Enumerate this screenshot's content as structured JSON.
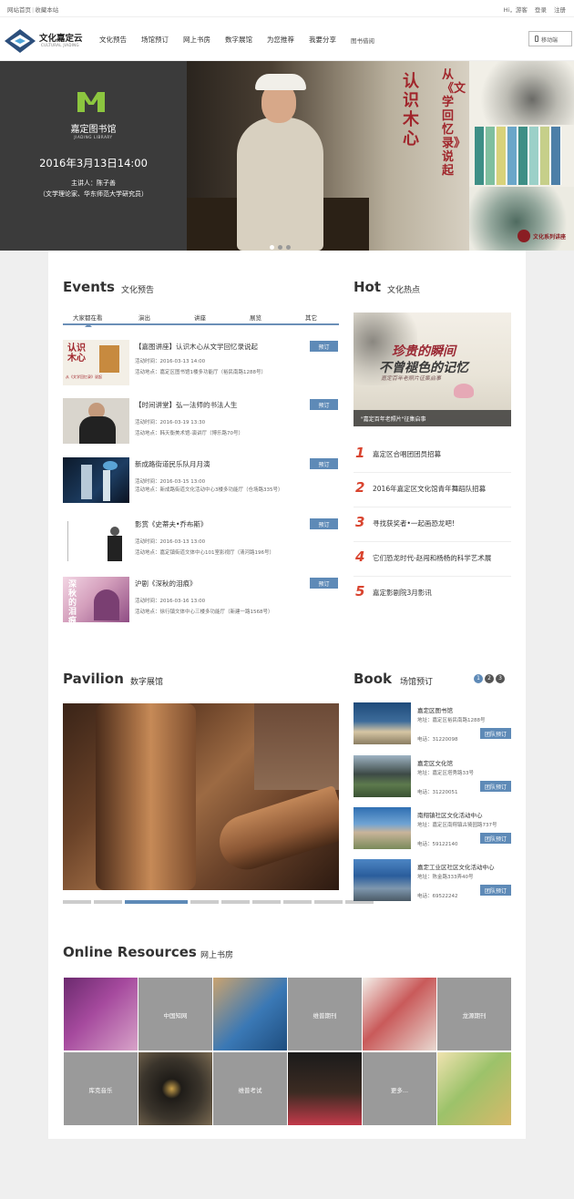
{
  "topbar": {
    "home": "网站首页",
    "favorite": "收藏本站",
    "greeting": "Hi，游客",
    "login": "登录",
    "register": "注册"
  },
  "brand": {
    "cn": "文化嘉定云",
    "en": "CULTURAL JIADING"
  },
  "nav": [
    "文化预告",
    "场馆预订",
    "网上书房",
    "数字展馆",
    "为您推荐",
    "我要分享",
    "图书借阅"
  ],
  "mobile": "移动端",
  "hero": {
    "library_cn": "嘉定图书馆",
    "library_en": "JIADING LIBRARY",
    "date": "2016年3月13日14:00",
    "speaker": "主讲人：陈子善",
    "desc": "（文学理论家、华东师范大学研究员）",
    "title_a": "认识木心",
    "title_b": "从《文学回忆录》说起",
    "series": "文化系列讲座",
    "slide_index": 1,
    "slide_count": 3
  },
  "events": {
    "title_en": "Events",
    "title_cn": "文化预告",
    "tabs": [
      "大家都在看",
      "演出",
      "讲座",
      "展览",
      "其它"
    ],
    "active_tab": "大家都在看",
    "items": [
      {
        "title": "【嘉图讲座】认识木心从文学回忆录说起",
        "time": "活动时间：2016-03-13 14:00",
        "place": "活动地点：嘉定区图书馆1楼多功能厅（裕民南路1288号）",
        "btn": "预订",
        "thumb": "book-cover"
      },
      {
        "title": "【时间讲堂】弘一法师的书法人生",
        "time": "活动时间：2016-03-19 13:30",
        "place": "活动地点：韩天衡美术馆-演讲厅（博乐路70号）",
        "btn": "预订",
        "thumb": "monk"
      },
      {
        "title": "新成路街道民乐队月月演",
        "time": "活动时间：2016-03-15 13:00",
        "place": "活动地点：新成路街道文化活动中心3楼多功能厅（仓场路335号）",
        "btn": "预订",
        "thumb": "stage"
      },
      {
        "title": "影赏《史蒂夫•乔布斯》",
        "time": "活动时间：2016-03-13 13:00",
        "place": "活动地点：嘉定镇街道文体中心101室影视厅（清河路196号）",
        "btn": "预订",
        "thumb": "poster"
      },
      {
        "title": "沪剧《深秋的泪痕》",
        "time": "活动时间：2016-03-16 13:00",
        "place": "活动地点：徐行镇文体中心三楼多功能厅（新建一路1568号）",
        "btn": "预订",
        "thumb": "opera"
      }
    ]
  },
  "hot": {
    "title_en": "Hot",
    "title_cn": "文化热点",
    "image_caption": "\"嘉定百年老照片\"征集启事",
    "calli1": "珍贵的瞬间",
    "calli2": "不曾褪色的记忆",
    "calli3": "嘉定百年老照片征集启事",
    "items": [
      {
        "num": "1",
        "text": "嘉定区合唱团团员招募"
      },
      {
        "num": "2",
        "text": "2016年嘉定区文化馆青年舞蹈队招募"
      },
      {
        "num": "3",
        "text": "寻找获奖者•一起画恐龙吧!"
      },
      {
        "num": "4",
        "text": "它们恐龙时代-赵闯和杨杨的科学艺术展"
      },
      {
        "num": "5",
        "text": "嘉定影剧院3月影讯"
      }
    ]
  },
  "pavilion": {
    "title_en": "Pavilion",
    "title_cn": "数字展馆",
    "slide_count": 9,
    "active_slide": 3
  },
  "book": {
    "title_en": "Book",
    "title_cn": "场馆预订",
    "pages": [
      "1",
      "2",
      "3"
    ],
    "active_page": "1",
    "venues": [
      {
        "name": "嘉定区图书馆",
        "addr": "地址：嘉定区裕民南路1288号",
        "tel": "电话：31220098",
        "btn": "团队预订"
      },
      {
        "name": "嘉定区文化馆",
        "addr": "地址：嘉定区塔秀路33号",
        "tel": "电话：31220051",
        "btn": "团队预订"
      },
      {
        "name": "南翔镇社区文化活动中心",
        "addr": "地址：嘉定区南翔镇古猗园路737号",
        "tel": "电话：59122140",
        "btn": "团队预订"
      },
      {
        "name": "嘉定工业区社区文化活动中心",
        "addr": "地址：陈金路333弄40号",
        "tel": "电话：69522242",
        "btn": "团队预订"
      }
    ]
  },
  "resources": {
    "title_en": "Online Resources",
    "title_cn": "网上书房",
    "tiles": [
      "中国知网",
      "维普期刊",
      "龙源期刊",
      "库克音乐",
      "维普考试",
      "更多..."
    ]
  },
  "colors": {
    "accent": "#5e8ab7",
    "hot_number": "#d9442f",
    "hero_red": "#a0252b"
  }
}
